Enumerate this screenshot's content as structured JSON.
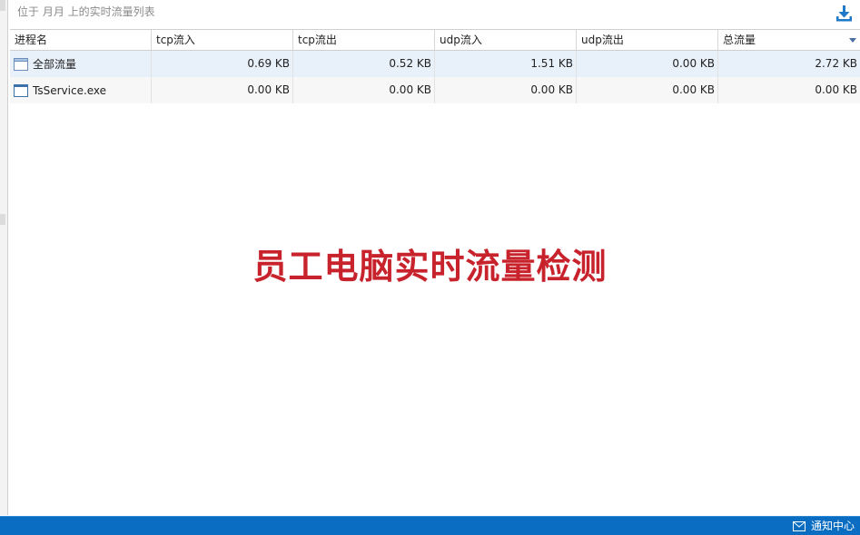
{
  "header": {
    "title": "位于 月月 上的实时流量列表"
  },
  "table": {
    "columns": [
      "进程名",
      "tcp流入",
      "tcp流出",
      "udp流入",
      "udp流出",
      "总流量"
    ],
    "sorted_column": "总流量",
    "rows": [
      {
        "name": "全部流量",
        "tcp_in": "0.69 KB",
        "tcp_out": "0.52 KB",
        "udp_in": "1.51 KB",
        "udp_out": "0.00 KB",
        "total": "2.72 KB",
        "icon": "window-icon"
      },
      {
        "name": "TsService.exe",
        "tcp_in": "0.00 KB",
        "tcp_out": "0.00 KB",
        "udp_in": "0.00 KB",
        "udp_out": "0.00 KB",
        "total": "0.00 KB",
        "icon": "application-icon"
      }
    ]
  },
  "overlay": {
    "headline": "员工电脑实时流量检测"
  },
  "taskbar": {
    "notify_label": "通知中心"
  },
  "colors": {
    "accent": "#0a6dc2",
    "headline": "#c8232c",
    "selected_row": "#e8f0fa"
  }
}
